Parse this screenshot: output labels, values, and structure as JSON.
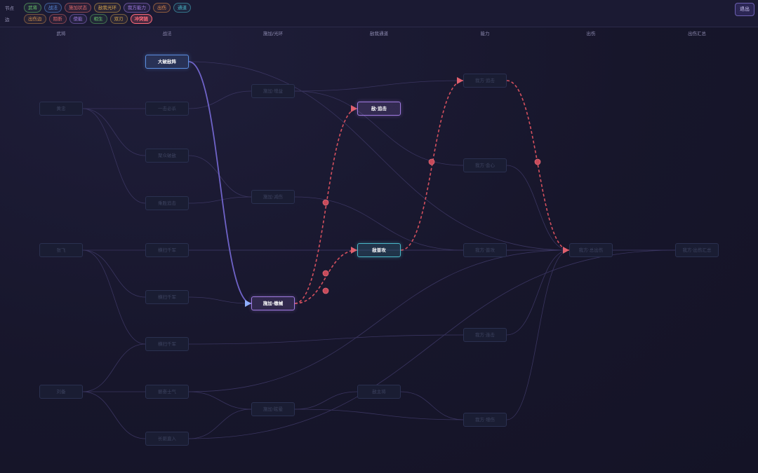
{
  "toolbar": {
    "node_label": "节点",
    "edge_label": "边",
    "node_filters": [
      {
        "label": "武将",
        "color": "#6ac46a"
      },
      {
        "label": "战法",
        "color": "#5b8ee0"
      },
      {
        "label": "施加状态",
        "color": "#e06a6a"
      },
      {
        "label": "敌我光环",
        "color": "#d6a54a"
      },
      {
        "label": "我方能力",
        "color": "#a07ae0"
      },
      {
        "label": "出伤",
        "color": "#e08a4a"
      },
      {
        "label": "通道",
        "color": "#4ab8c8"
      }
    ],
    "edge_filters": [
      {
        "label": "出伤边",
        "color": "#d6924a",
        "active": false
      },
      {
        "label": "阻断",
        "color": "#e06a6a",
        "active": false
      },
      {
        "label": "使能",
        "color": "#a07ae0",
        "active": false
      },
      {
        "label": "相生",
        "color": "#6ac46a",
        "active": false
      },
      {
        "label": "双刃",
        "color": "#d6a54a",
        "active": false
      },
      {
        "label": "冲突链",
        "color": "#ff6a7a",
        "active": true
      }
    ],
    "exit_label": "退出"
  },
  "columns": [
    "武将",
    "战法",
    "施加/光环",
    "敌我通道",
    "能力",
    "出伤",
    "出伤汇总"
  ],
  "nodes": [
    {
      "id": "n1",
      "col": 0,
      "label": "黄忠"
    },
    {
      "id": "n2",
      "col": 0,
      "label": "张飞"
    },
    {
      "id": "n3",
      "col": 0,
      "label": "刘备"
    },
    {
      "id": "n4",
      "col": 1,
      "label": "大破敌阵",
      "highlight": true,
      "color": "#5b8ee0"
    },
    {
      "id": "n5",
      "col": 1,
      "label": "一击必杀"
    },
    {
      "id": "n6",
      "col": 1,
      "label": "聚众破敌"
    },
    {
      "id": "n7",
      "col": 1,
      "label": "乘胜追击"
    },
    {
      "id": "n8",
      "col": 1,
      "label": "横扫千军"
    },
    {
      "id": "n9",
      "col": 1,
      "label": "横扫千军"
    },
    {
      "id": "n10",
      "col": 1,
      "label": "横扫千军"
    },
    {
      "id": "n11",
      "col": 1,
      "label": "振奋士气"
    },
    {
      "id": "n12",
      "col": 1,
      "label": "长驱直入"
    },
    {
      "id": "n13",
      "col": 2,
      "label": "施加·增益"
    },
    {
      "id": "n14",
      "col": 2,
      "label": "施加·减伤"
    },
    {
      "id": "n15",
      "col": 2,
      "label": "施加·缴械",
      "highlight": true,
      "color": "#a07ae0"
    },
    {
      "id": "n16",
      "col": 2,
      "label": "施加·眩晕"
    },
    {
      "id": "n17",
      "col": 3,
      "label": "敌·追击",
      "highlight": true,
      "color": "#a07ae0"
    },
    {
      "id": "n18",
      "col": 3,
      "label": "敌普攻",
      "highlight": true,
      "color": "#4ab8c8"
    },
    {
      "id": "n19",
      "col": 3,
      "label": "敌主将"
    },
    {
      "id": "n20",
      "col": 4,
      "label": "我方·追击"
    },
    {
      "id": "n21",
      "col": 4,
      "label": "我方·会心"
    },
    {
      "id": "n22",
      "col": 4,
      "label": "我方·普攻"
    },
    {
      "id": "n23",
      "col": 4,
      "label": "我方·连击"
    },
    {
      "id": "n24",
      "col": 4,
      "label": "我方·增伤"
    },
    {
      "id": "n25",
      "col": 5,
      "label": "我方·总出伤"
    },
    {
      "id": "n26",
      "col": 6,
      "label": "我方·出伤汇总"
    }
  ],
  "edges": [
    {
      "from": "n4",
      "to": "n15",
      "type": "highlight"
    },
    {
      "from": "n15",
      "to": "n17",
      "type": "conflict"
    },
    {
      "from": "n15",
      "to": "n18",
      "type": "conflict"
    },
    {
      "from": "n18",
      "to": "n20",
      "type": "conflict"
    },
    {
      "from": "n20",
      "to": "n25",
      "type": "conflict"
    }
  ]
}
